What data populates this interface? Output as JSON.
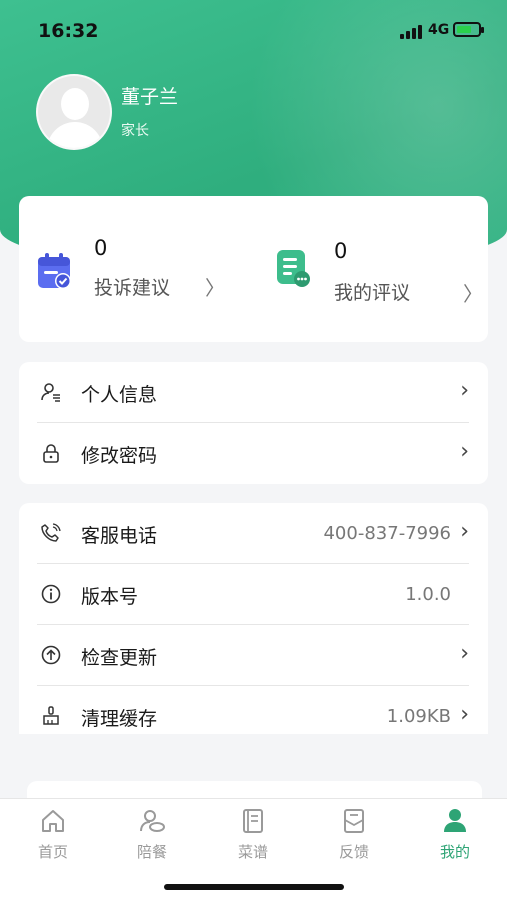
{
  "status_bar": {
    "time": "16:32",
    "network": "4G"
  },
  "profile": {
    "name": "董子兰",
    "role": "家长"
  },
  "stats": [
    {
      "count": "0",
      "label": "投诉建议",
      "icon": "calendar-check-icon"
    },
    {
      "count": "0",
      "label": "我的评议",
      "icon": "note-comment-icon"
    }
  ],
  "menu_account": [
    {
      "label": "个人信息",
      "icon": "person-info-icon"
    },
    {
      "label": "修改密码",
      "icon": "lock-icon"
    }
  ],
  "menu_app": [
    {
      "label": "客服电话",
      "value": "400-837-7996",
      "icon": "phone-icon"
    },
    {
      "label": "版本号",
      "value": "1.0.0",
      "icon": "info-icon"
    },
    {
      "label": "检查更新",
      "value": "",
      "icon": "upload-icon"
    },
    {
      "label": "清理缓存",
      "value": "1.09KB",
      "icon": "brush-icon"
    }
  ],
  "tabs": [
    {
      "label": "首页",
      "icon": "home-icon"
    },
    {
      "label": "陪餐",
      "icon": "dining-icon"
    },
    {
      "label": "菜谱",
      "icon": "menu-book-icon"
    },
    {
      "label": "反馈",
      "icon": "feedback-icon"
    },
    {
      "label": "我的",
      "icon": "profile-icon",
      "active": true
    }
  ],
  "colors": {
    "brand": "#2ea475",
    "header": "#33b384"
  }
}
